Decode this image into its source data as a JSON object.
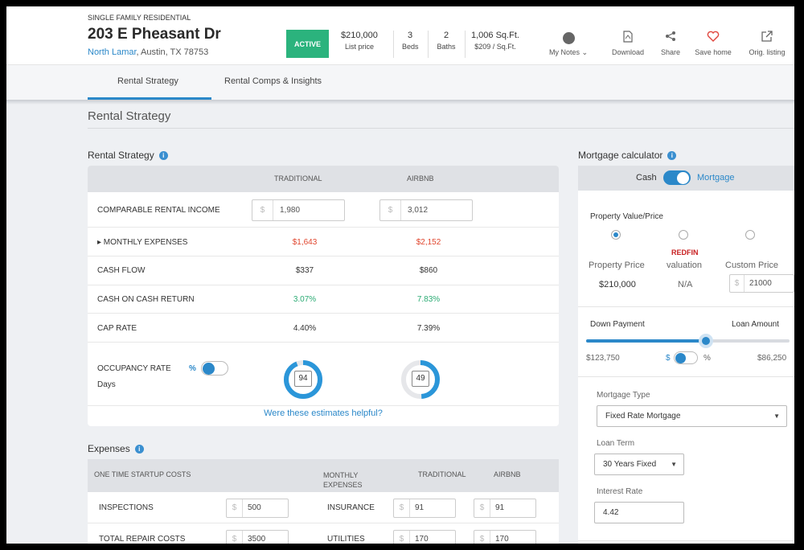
{
  "header": {
    "property_type": "SINGLE FAMILY RESIDENTIAL",
    "address": "203 E Pheasant Dr",
    "neighborhood": "North Lamar",
    "city_state": ", Austin, TX 78753",
    "status": "ACTIVE",
    "price": "$210,000",
    "price_label": "List price",
    "beds": "3",
    "beds_label": "Beds",
    "baths": "2",
    "baths_label": "Baths",
    "sqft": "1,006 Sq.Ft.",
    "price_per_sqft": "$209 / Sq.Ft.",
    "actions": {
      "notes": "My Notes ⌄",
      "download": "Download",
      "share": "Share",
      "save": "Save home",
      "orig": "Orig. listing"
    }
  },
  "tabs": [
    "Rental Strategy",
    "Rental Comps & Insights"
  ],
  "section_title": "Rental Strategy",
  "rental_strategy": {
    "title": "Rental Strategy",
    "col_traditional": "TRADITIONAL",
    "col_airbnb": "AIRBNB",
    "currency_symbol": "$",
    "rows": {
      "income": {
        "label": "COMPARABLE RENTAL INCOME",
        "traditional": "1,980",
        "airbnb": "3,012"
      },
      "expenses": {
        "label": "▸ MONTHLY EXPENSES",
        "traditional": "$1,643",
        "airbnb": "$2,152"
      },
      "cashflow": {
        "label": "CASH FLOW",
        "traditional": "$337",
        "airbnb": "$860"
      },
      "coc": {
        "label": "CASH ON CASH RETURN",
        "traditional": "3.07%",
        "airbnb": "7.83%"
      },
      "cap": {
        "label": "CAP RATE",
        "traditional": "4.40%",
        "airbnb": "7.39%"
      }
    },
    "occupancy": {
      "label": "OCCUPANCY RATE",
      "unit_pct": "%",
      "unit_days": "Days",
      "traditional": "94",
      "airbnb": "49"
    },
    "helpful": "Were these estimates helpful?"
  },
  "expenses": {
    "title": "Expenses",
    "startup_header": "ONE TIME STARTUP COSTS",
    "monthly_header": "MONTHLY EXPENSES",
    "col_traditional": "TRADITIONAL",
    "col_airbnb": "AIRBNB",
    "currency_symbol": "$",
    "startup_rows": [
      {
        "label": "INSPECTIONS",
        "value": "500"
      },
      {
        "label": "TOTAL REPAIR COSTS",
        "value": "3500"
      }
    ],
    "monthly_rows": [
      {
        "label": "INSURANCE",
        "traditional": "91",
        "airbnb": "91"
      },
      {
        "label": "UTILITIES",
        "traditional": "170",
        "airbnb": "170"
      }
    ]
  },
  "mortgage": {
    "title": "Mortgage calculator",
    "toggle_left": "Cash",
    "toggle_right": "Mortgage",
    "property_value_label": "Property Value/Price",
    "opt_property_price": "Property Price",
    "opt_redfin": "REDFIN",
    "opt_valuation": "valuation",
    "opt_custom": "Custom Price",
    "property_price_value": "$210,000",
    "valuation_value": "N/A",
    "custom_currency": "$",
    "custom_value": "21000",
    "down_payment_label": "Down Payment",
    "loan_amount_label": "Loan Amount",
    "slider_fraction": 0.59,
    "down_payment_value": "$123,750",
    "unit_dollar": "$",
    "unit_pct": "%",
    "loan_amount_value": "$86,250",
    "mortgage_type_label": "Mortgage Type",
    "mortgage_type_value": "Fixed Rate Mortgage",
    "loan_term_label": "Loan Term",
    "loan_term_value": "30 Years Fixed",
    "interest_label": "Interest Rate",
    "interest_value": "4.42"
  },
  "colors": {
    "accent": "#2b88c9",
    "active_badge": "#2bb37d",
    "negative": "#e0462e",
    "positive": "#2bab74",
    "redfin": "#c82021"
  }
}
